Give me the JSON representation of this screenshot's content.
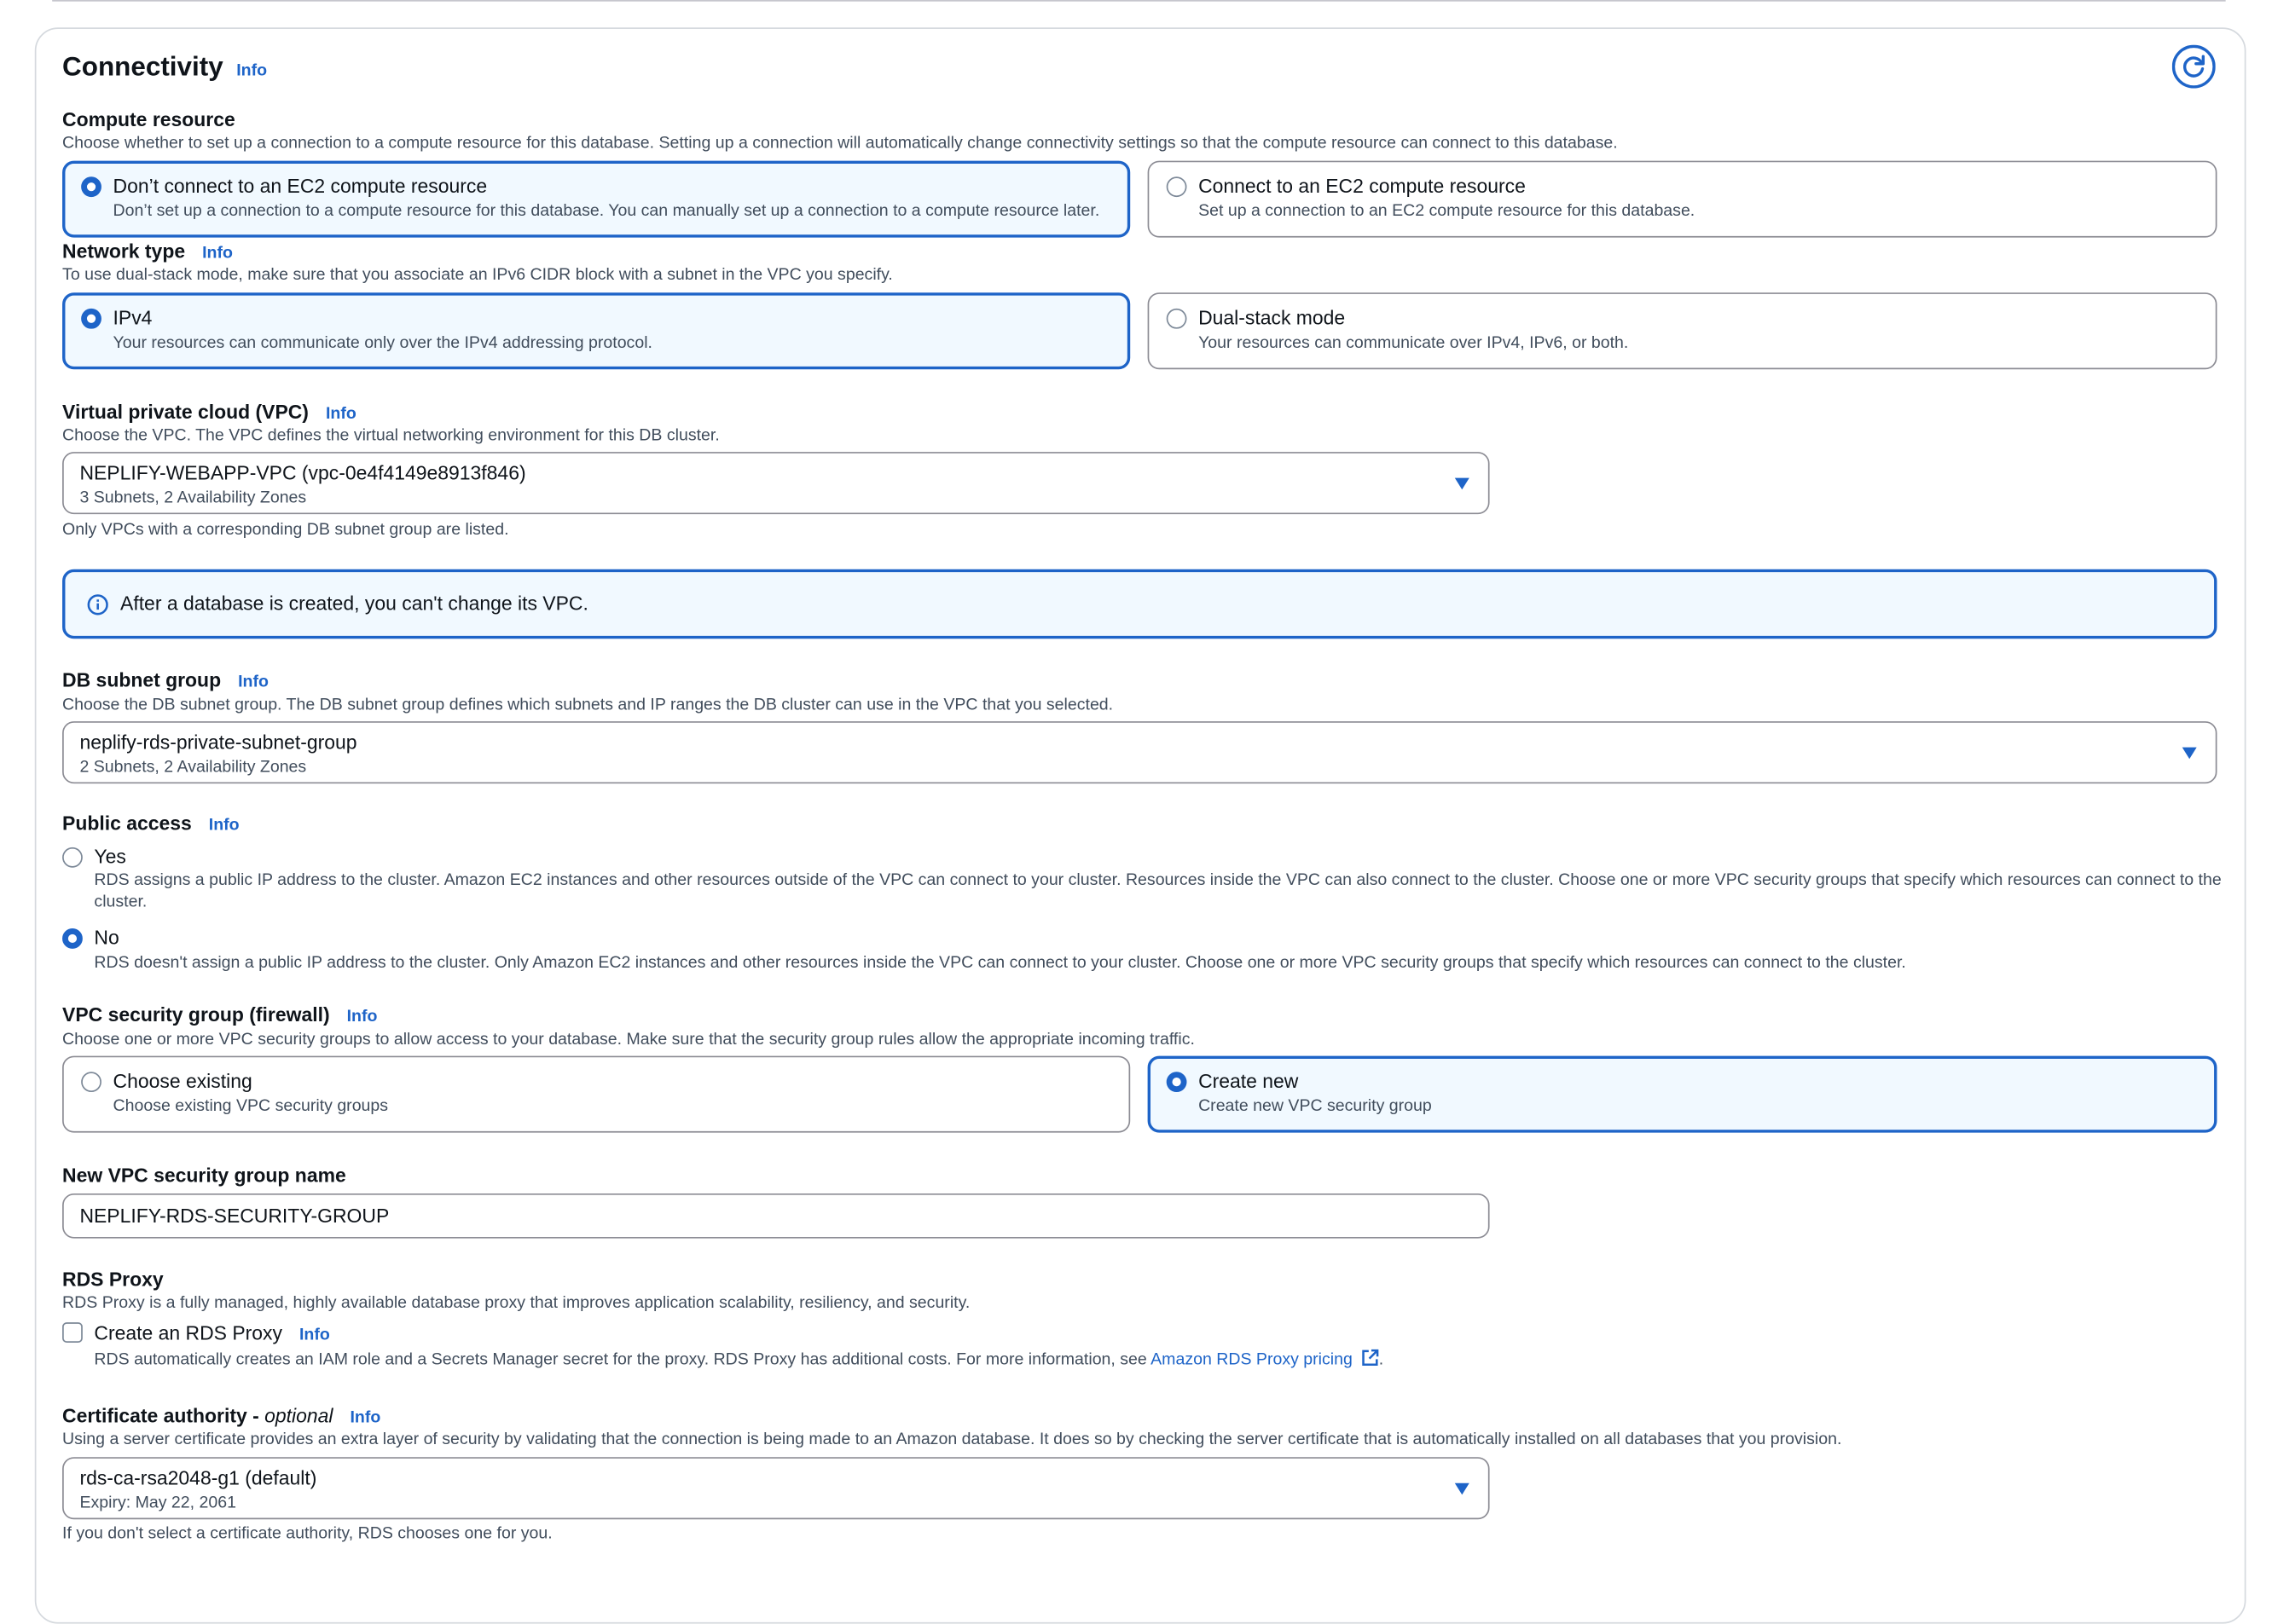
{
  "section": {
    "title": "Connectivity",
    "info": "Info"
  },
  "compute": {
    "label": "Compute resource",
    "description": "Choose whether to set up a connection to a compute resource for this database. Setting up a connection will automatically change connectivity settings so that the compute resource can connect to this database.",
    "options": [
      {
        "title": "Don’t connect to an EC2 compute resource",
        "desc": "Don’t set up a connection to a compute resource for this database. You can manually set up a connection to a compute resource later.",
        "selected": true
      },
      {
        "title": "Connect to an EC2 compute resource",
        "desc": "Set up a connection to an EC2 compute resource for this database.",
        "selected": false
      }
    ]
  },
  "network": {
    "label": "Network type",
    "info": "Info",
    "description": "To use dual-stack mode, make sure that you associate an IPv6 CIDR block with a subnet in the VPC you specify.",
    "options": [
      {
        "title": "IPv4",
        "desc": "Your resources can communicate only over the IPv4 addressing protocol.",
        "selected": true
      },
      {
        "title": "Dual-stack mode",
        "desc": "Your resources can communicate over IPv4, IPv6, or both.",
        "selected": false
      }
    ]
  },
  "vpc": {
    "label": "Virtual private cloud (VPC)",
    "info": "Info",
    "description": "Choose the VPC. The VPC defines the virtual networking environment for this DB cluster.",
    "value": "NEPLIFY-WEBAPP-VPC (vpc-0e4f4149e8913f846)",
    "sub": "3 Subnets, 2 Availability Zones",
    "hint": "Only VPCs with a corresponding DB subnet group are listed.",
    "alert": "After a database is created, you can't change its VPC."
  },
  "subnet": {
    "label": "DB subnet group",
    "info": "Info",
    "description": "Choose the DB subnet group. The DB subnet group defines which subnets and IP ranges the DB cluster can use in the VPC that you selected.",
    "value": "neplify-rds-private-subnet-group",
    "sub": "2 Subnets, 2 Availability Zones"
  },
  "public": {
    "label": "Public access",
    "info": "Info",
    "yes": {
      "title": "Yes",
      "desc1": "RDS assigns a public IP address to the cluster. Amazon EC2 instances and other resources outside of the VPC can connect to your cluster. Resources inside the VPC can also connect to the cluster. Choose one or more VPC security groups that specify which resources can connect to the",
      "desc2": "cluster.",
      "selected": false
    },
    "no": {
      "title": "No",
      "desc": "RDS doesn't assign a public IP address to the cluster. Only Amazon EC2 instances and other resources inside the VPC can connect to your cluster. Choose one or more VPC security groups that specify which resources can connect to the cluster.",
      "selected": true
    }
  },
  "sg": {
    "label": "VPC security group (firewall)",
    "info": "Info",
    "description": "Choose one or more VPC security groups to allow access to your database. Make sure that the security group rules allow the appropriate incoming traffic.",
    "options": [
      {
        "title": "Choose existing",
        "desc": "Choose existing VPC security groups",
        "selected": false
      },
      {
        "title": "Create new",
        "desc": "Create new VPC security group",
        "selected": true
      }
    ]
  },
  "sgname": {
    "label": "New VPC security group name",
    "value": "NEPLIFY-RDS-SECURITY-GROUP"
  },
  "proxy": {
    "label": "RDS Proxy",
    "description": "RDS Proxy is a fully managed, highly available database proxy that improves application scalability, resiliency, and security.",
    "checkbox": "Create an RDS Proxy",
    "info": "Info",
    "note": "RDS automatically creates an IAM role and a Secrets Manager secret for the proxy. RDS Proxy has additional costs. For more information, see ",
    "link": "Amazon RDS Proxy pricing",
    "checked": false
  },
  "cert": {
    "label": "Certificate authority - ",
    "optional": "optional",
    "info": "Info",
    "description": "Using a server certificate provides an extra layer of security by validating that the connection is being made to an Amazon database. It does so by checking the server certificate that is automatically installed on all databases that you provision.",
    "value": "rds-ca-rsa2048-g1 (default)",
    "sub": "Expiry: May 22, 2061",
    "hint": "If you don't select a certificate authority, RDS chooses one for you."
  },
  "colors": {
    "accent": "#1e64c8",
    "selected_bg": "#f1f9ff",
    "border": "#8c8c94"
  },
  "icons": {
    "refresh": "refresh-icon",
    "info": "info-circle-icon",
    "external": "external-link-icon",
    "caret": "caret-down-icon"
  }
}
